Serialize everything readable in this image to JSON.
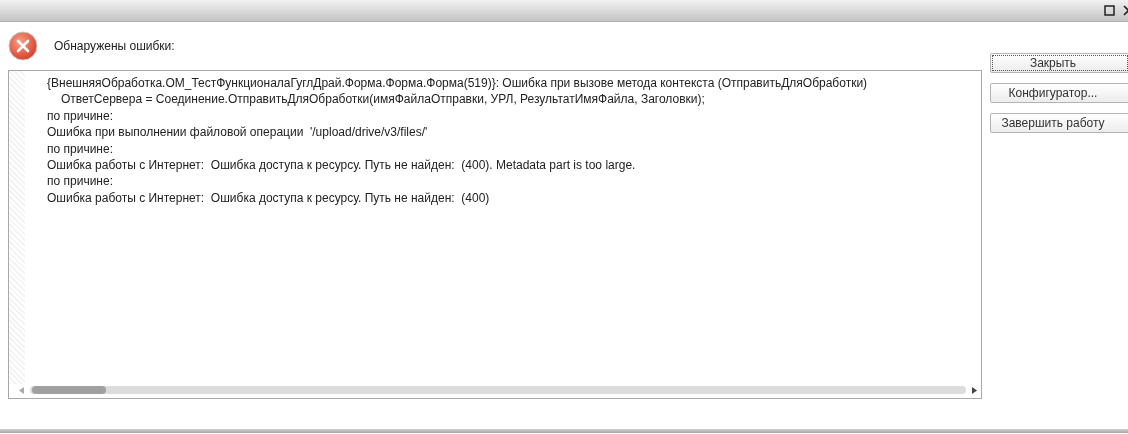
{
  "window": {
    "controls": [
      {
        "kind": "maximize"
      },
      {
        "kind": "close"
      }
    ]
  },
  "header": {
    "message": "Обнаружены ошибки:"
  },
  "error_text": {
    "lines": [
      {
        "kind": "plain",
        "text": "{ВнешняяОбработка.ОМ_ТестФункционалаГуглДрай.Форма.Форма.Форма(519)}: Ошибка при вызове метода контекста (ОтправитьДляОбработки)"
      },
      {
        "kind": "indented",
        "text": "ОтветСервера = Соединение.ОтправитьДляОбработки(имяФайлаОтправки, УРЛ, РезультатИмяФайла, Заголовки);"
      },
      {
        "kind": "plain",
        "text": "по причине:"
      },
      {
        "kind": "plain",
        "text": "Ошибка при выполнении файловой операции  '/upload/drive/v3/files/'"
      },
      {
        "kind": "plain",
        "text": "по причине:"
      },
      {
        "kind": "plain",
        "text": "Ошибка работы с Интернет:  Ошибка доступа к ресурсу. Путь не найден:  (400). Metadata part is too large."
      },
      {
        "kind": "plain",
        "text": "по причине:"
      },
      {
        "kind": "plain",
        "text": "Ошибка работы с Интернет:  Ошибка доступа к ресурсу. Путь не найден:  (400)"
      }
    ]
  },
  "buttons": [
    {
      "label": "Закрыть",
      "focused": true
    },
    {
      "label": "Конфигуратор...",
      "focused": false
    },
    {
      "label": "Завершить работу",
      "focused": false
    }
  ]
}
